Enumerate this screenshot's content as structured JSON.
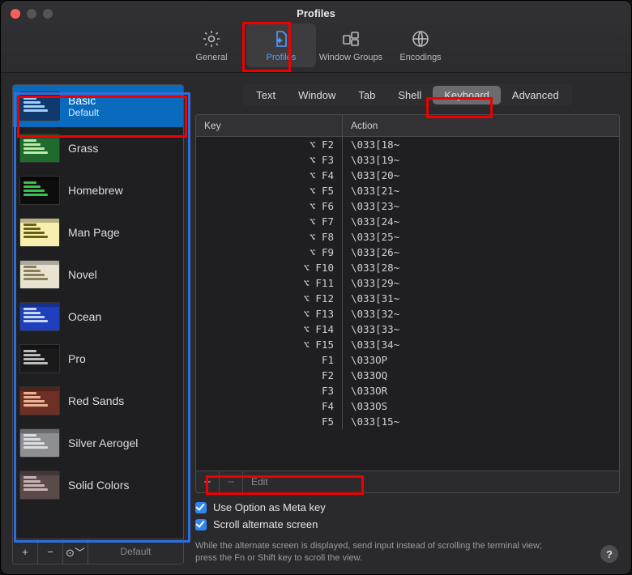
{
  "window": {
    "title": "Profiles"
  },
  "toolbar": {
    "items": [
      {
        "id": "general",
        "label": "General"
      },
      {
        "id": "profiles",
        "label": "Profiles",
        "selected": true
      },
      {
        "id": "window-groups",
        "label": "Window Groups"
      },
      {
        "id": "encodings",
        "label": "Encodings"
      }
    ]
  },
  "sidebar": {
    "profiles": [
      {
        "name": "Basic",
        "sub": "Default",
        "selected": true,
        "bg": "#103a6e",
        "fg": "#9ecfff"
      },
      {
        "name": "Grass",
        "bg": "#1f6b2e",
        "fg": "#bfe9a8"
      },
      {
        "name": "Homebrew",
        "bg": "#0d0d0d",
        "fg": "#38c24b"
      },
      {
        "name": "Man Page",
        "bg": "#f7efad",
        "fg": "#6b5f16"
      },
      {
        "name": "Novel",
        "bg": "#e8e3cf",
        "fg": "#8a7e5a"
      },
      {
        "name": "Ocean",
        "bg": "#1f3fbf",
        "fg": "#c7d8ff"
      },
      {
        "name": "Pro",
        "bg": "#1a1a1a",
        "fg": "#bdbdbd"
      },
      {
        "name": "Red Sands",
        "bg": "#6e2f25",
        "fg": "#e7b394"
      },
      {
        "name": "Silver Aerogel",
        "bg": "#8d8f93",
        "fg": "#dadce0"
      },
      {
        "name": "Solid Colors",
        "bg": "#5a4a4a",
        "fg": "#c8b4b4"
      }
    ],
    "footer": {
      "add": "+",
      "remove": "−",
      "menu": "⊙",
      "default_label": "Default"
    }
  },
  "tabs": {
    "items": [
      "Text",
      "Window",
      "Tab",
      "Shell",
      "Keyboard",
      "Advanced"
    ],
    "selected": "Keyboard"
  },
  "keymap": {
    "columns": {
      "key": "Key",
      "action": "Action"
    },
    "rows": [
      {
        "key": "⌥ F2",
        "action": "\\033[18~"
      },
      {
        "key": "⌥ F3",
        "action": "\\033[19~"
      },
      {
        "key": "⌥ F4",
        "action": "\\033[20~"
      },
      {
        "key": "⌥ F5",
        "action": "\\033[21~"
      },
      {
        "key": "⌥ F6",
        "action": "\\033[23~"
      },
      {
        "key": "⌥ F7",
        "action": "\\033[24~"
      },
      {
        "key": "⌥ F8",
        "action": "\\033[25~"
      },
      {
        "key": "⌥ F9",
        "action": "\\033[26~"
      },
      {
        "key": "⌥ F10",
        "action": "\\033[28~"
      },
      {
        "key": "⌥ F11",
        "action": "\\033[29~"
      },
      {
        "key": "⌥ F12",
        "action": "\\033[31~"
      },
      {
        "key": "⌥ F13",
        "action": "\\033[32~"
      },
      {
        "key": "⌥ F14",
        "action": "\\033[33~"
      },
      {
        "key": "⌥ F15",
        "action": "\\033[34~"
      },
      {
        "key": "F1",
        "action": "\\033OP"
      },
      {
        "key": "F2",
        "action": "\\033OQ"
      },
      {
        "key": "F3",
        "action": "\\033OR"
      },
      {
        "key": "F4",
        "action": "\\033OS"
      },
      {
        "key": "F5",
        "action": "\\033[15~"
      }
    ],
    "footer": {
      "add": "+",
      "remove": "−",
      "edit": "Edit"
    }
  },
  "options": {
    "use_option_meta": {
      "label": "Use Option as Meta key",
      "checked": true
    },
    "scroll_alt": {
      "label": "Scroll alternate screen",
      "checked": true
    },
    "hint": "While the alternate screen is displayed, send input instead of scrolling the terminal view; press the Fn or Shift key to scroll the view."
  },
  "help": {
    "glyph": "?"
  }
}
